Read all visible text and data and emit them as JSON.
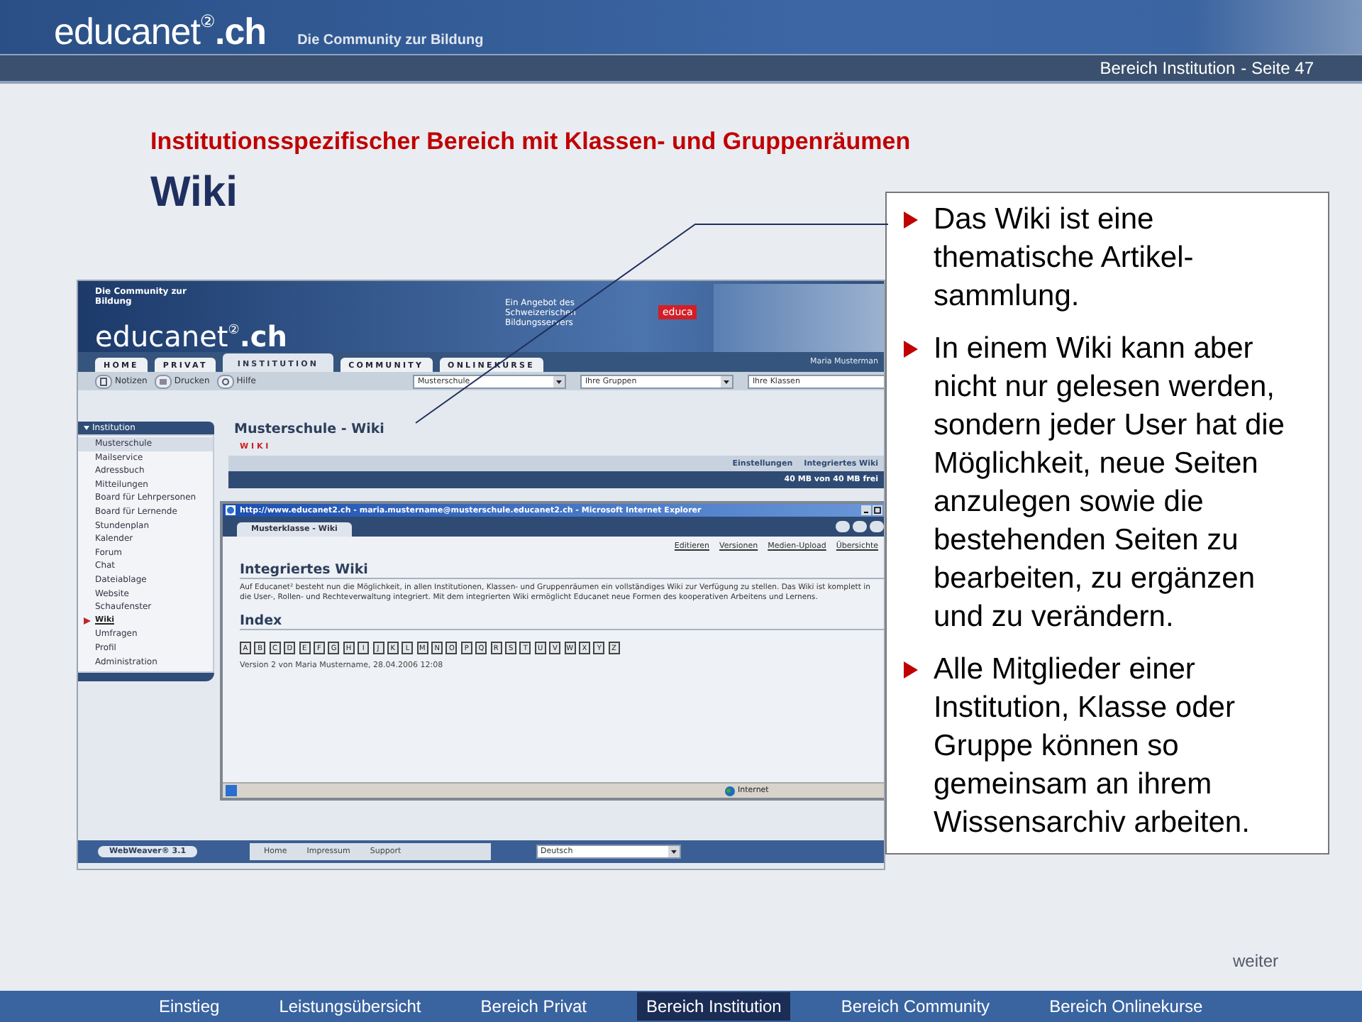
{
  "header": {
    "logo": {
      "name": "educanet",
      "mark": "②",
      "suffix": ".ch"
    },
    "tagline": "Die Community zur Bildung",
    "section": "Bereich Institution",
    "page": "- Seite 47"
  },
  "slide": {
    "subtitle": "Institutionsspezifischer Bereich mit Klassen- und Gruppenräumen",
    "title": "Wiki"
  },
  "screenshot": {
    "banner": {
      "tagline": "Die Community zur Bildung",
      "logo": {
        "name": "educanet",
        "mark": "②",
        "suffix": ".ch"
      },
      "provider": "Ein Angebot des Schweizerischen Bildungsservers",
      "badge": "educa"
    },
    "tabs": [
      {
        "label": "HOME",
        "selected": false
      },
      {
        "label": "PRIVAT",
        "selected": false
      },
      {
        "label": "INSTITUTION",
        "selected": true
      },
      {
        "label": "COMMUNITY",
        "selected": false
      },
      {
        "label": "ONLINEKURSE",
        "selected": false
      }
    ],
    "user": "Maria Musterman",
    "tools": [
      {
        "kind": "notes",
        "label": "Notizen"
      },
      {
        "kind": "print",
        "label": "Drucken"
      },
      {
        "kind": "help",
        "label": "Hilfe"
      }
    ],
    "selects": [
      "Musterschule",
      "Ihre Gruppen",
      "Ihre Klassen"
    ],
    "sidebar": {
      "header": "Institution",
      "items": [
        {
          "label": "Musterschule",
          "selected": true,
          "active": false
        },
        {
          "label": "Mailservice",
          "selected": false,
          "active": false
        },
        {
          "label": "Adressbuch",
          "selected": false,
          "active": false
        },
        {
          "label": "Mitteilungen",
          "selected": false,
          "active": false
        },
        {
          "label": "Board für Lehrpersonen",
          "selected": false,
          "active": false
        },
        {
          "label": "Board für Lernende",
          "selected": false,
          "active": false
        },
        {
          "label": "Stundenplan",
          "selected": false,
          "active": false
        },
        {
          "label": "Kalender",
          "selected": false,
          "active": false
        },
        {
          "label": "Forum",
          "selected": false,
          "active": false
        },
        {
          "label": "Chat",
          "selected": false,
          "active": false
        },
        {
          "label": "Dateiablage",
          "selected": false,
          "active": false
        },
        {
          "label": "Website",
          "selected": false,
          "active": false
        },
        {
          "label": "Schaufenster",
          "selected": false,
          "active": false
        },
        {
          "label": "Wiki",
          "selected": false,
          "active": true
        },
        {
          "label": "Umfragen",
          "selected": false,
          "active": false
        },
        {
          "label": "Profil",
          "selected": false,
          "active": false
        },
        {
          "label": "Administration",
          "selected": false,
          "active": false
        }
      ]
    },
    "page_title": "Musterschule - Wiki",
    "section_label": "W I K I",
    "links": [
      "Einstellungen",
      "Integriertes Wiki"
    ],
    "quota": "40 MB von 40 MB frei",
    "browser": {
      "title": "http://www.educanet2.ch - maria.mustername@musterschule.educanet2.ch - Microsoft Internet Explorer",
      "tab": "Musterklasse - Wiki",
      "actions": [
        "Editieren",
        "Versionen",
        "Medien-Upload",
        "Übersichte"
      ],
      "heading": "Integriertes Wiki",
      "paragraph": "Auf Educanet² besteht nun die Möglichkeit, in allen Institutionen, Klassen- und Gruppenräumen ein vollständiges Wiki zur Verfügung zu stellen. Das Wiki ist komplett in die User-, Rollen- und Rechteverwaltung integriert. Mit dem integrierten Wiki ermöglicht Educanet neue Formen des kooperativen Arbeitens und Lernens.",
      "index_heading": "Index",
      "letters": [
        "A",
        "B",
        "C",
        "D",
        "E",
        "F",
        "G",
        "H",
        "I",
        "J",
        "K",
        "L",
        "M",
        "N",
        "O",
        "P",
        "Q",
        "R",
        "S",
        "T",
        "U",
        "V",
        "W",
        "X",
        "Y",
        "Z"
      ],
      "version": "Version 2 von Maria Mustername, 28.04.2006 12:08",
      "status": "Internet"
    },
    "footer": {
      "badge": "WebWeaver® 3.1",
      "links": [
        "Home",
        "Impressum",
        "Support"
      ],
      "language": "Deutsch"
    }
  },
  "callout": [
    "Das Wiki ist eine thematische Artikel-sammlung.",
    "In einem Wiki kann aber nicht nur gelesen werden, sondern jeder User hat die Möglichkeit, neue Seiten anzulegen sowie die bestehenden Seiten zu bearbeiten, zu ergänzen und zu verändern.",
    "Alle Mitglieder einer Institution, Klasse oder Gruppe können so gemeinsam an ihrem Wissensarchiv arbeiten."
  ],
  "nav": {
    "more": "weiter",
    "items": [
      {
        "label": "Einstieg",
        "selected": false
      },
      {
        "label": "Leistungsübersicht",
        "selected": false
      },
      {
        "label": "Bereich Privat",
        "selected": false
      },
      {
        "label": "Bereich Institution",
        "selected": true
      },
      {
        "label": "Bereich Community",
        "selected": false
      },
      {
        "label": "Bereich Onlinekurse",
        "selected": false
      }
    ]
  }
}
